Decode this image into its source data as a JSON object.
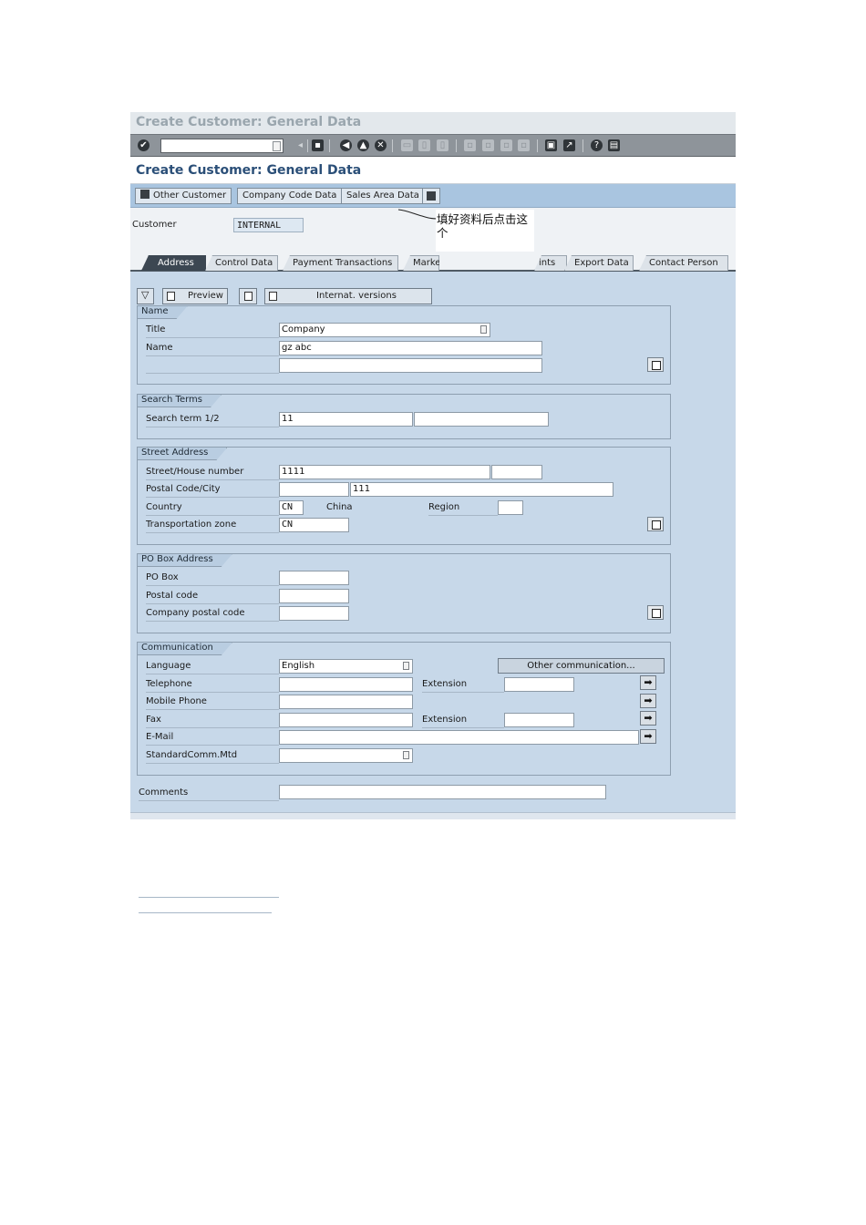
{
  "window": {
    "title": "Create Customer: General Data"
  },
  "screen": {
    "title": "Create Customer: General Data"
  },
  "app_toolbar": {
    "other_customer": "Other Customer",
    "company_code_data": "Company Code Data",
    "sales_area_data": "Sales Area Data"
  },
  "header": {
    "customer_label": "Customer",
    "customer_value": "INTERNAL"
  },
  "annotation": {
    "text": "填好资料后点击这个"
  },
  "tabs": [
    "Address",
    "Control Data",
    "Payment Transactions",
    "Marke",
    "ints",
    "Export Data",
    "Contact Person"
  ],
  "buttons": {
    "preview": "Preview",
    "internat_versions": "Internat. versions"
  },
  "name_group": {
    "title": "Name",
    "title_label": "Title",
    "title_value": "Company",
    "name_label": "Name",
    "name_value": "gz abc",
    "name2_value": ""
  },
  "search_group": {
    "title": "Search Terms",
    "label": "Search term 1/2",
    "term1": "11",
    "term2": ""
  },
  "street_group": {
    "title": "Street Address",
    "street_label": "Street/House number",
    "street_value": "1111",
    "house_value": "",
    "postal_label": "Postal Code/City",
    "postal_value": "",
    "city_value": "111",
    "country_label": "Country",
    "country_value": "CN",
    "country_name": "China",
    "region_label": "Region",
    "region_value": "",
    "transport_label": "Transportation zone",
    "transport_value": "CN"
  },
  "pobox_group": {
    "title": "PO Box Address",
    "pobox_label": "PO Box",
    "postal_label": "Postal code",
    "company_postal_label": "Company postal code"
  },
  "comm_group": {
    "title": "Communication",
    "language_label": "Language",
    "language_value": "English",
    "other_comm": "Other communication...",
    "telephone_label": "Telephone",
    "extension_label": "Extension",
    "mobile_label": "Mobile Phone",
    "fax_label": "Fax",
    "fax_extension_label": "Extension",
    "email_label": "E-Mail",
    "std_comm_label": "StandardComm.Mtd"
  },
  "comments": {
    "label": "Comments",
    "value": ""
  }
}
